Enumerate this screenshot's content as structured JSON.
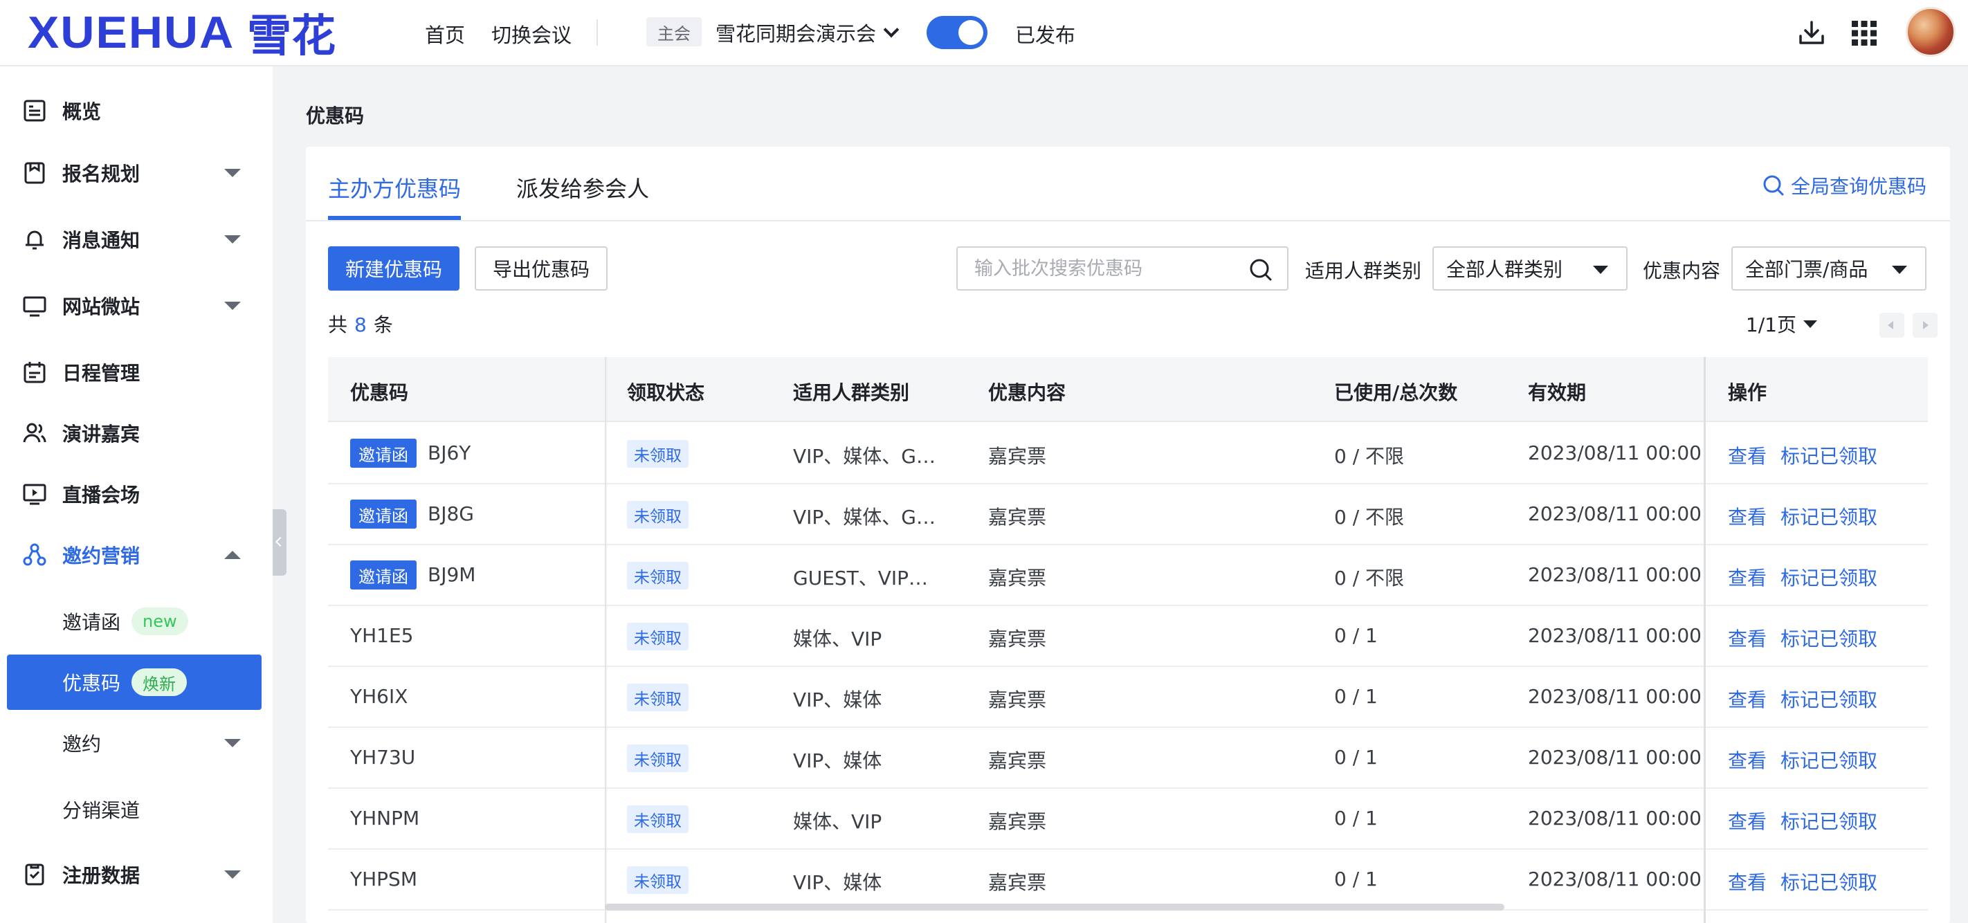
{
  "header": {
    "logo_en": "XUEHUA",
    "logo_cn": "雪花",
    "nav_home": "首页",
    "nav_switch": "切换会议",
    "main_tag": "主会",
    "event_name": "雪花同期会演示会",
    "published_label": "已发布",
    "published_on": true,
    "icons": [
      "download-icon",
      "apps-grid-icon",
      "avatar"
    ]
  },
  "sidebar": {
    "items": [
      {
        "label": "概览",
        "icon": "overview-icon"
      },
      {
        "label": "报名规划",
        "icon": "registration-plan-icon"
      },
      {
        "label": "消息通知",
        "icon": "bell-icon"
      },
      {
        "label": "网站微站",
        "icon": "monitor-icon"
      },
      {
        "label": "日程管理",
        "icon": "calendar-icon"
      },
      {
        "label": "演讲嘉宾",
        "icon": "speakers-icon"
      },
      {
        "label": "直播会场",
        "icon": "live-icon"
      },
      {
        "label": "邀约营销",
        "icon": "marketing-icon"
      }
    ],
    "sub_items": [
      {
        "label": "邀请函",
        "badge": "new"
      },
      {
        "label": "优惠码",
        "badge": "焕新"
      },
      {
        "label": "邀约"
      },
      {
        "label": "分销渠道"
      }
    ],
    "last_item": {
      "label": "注册数据",
      "icon": "register-data-icon"
    }
  },
  "main": {
    "page_title": "优惠码",
    "tabs": [
      {
        "label": "主办方优惠码"
      },
      {
        "label": "派发给参会人"
      }
    ],
    "global_search": "全局查询优惠码",
    "new_button": "新建优惠码",
    "export_button": "导出优惠码",
    "search_placeholder": "输入批次搜索优惠码",
    "filter_group_label": "适用人群类别",
    "filter_group_value": "全部人群类别",
    "filter_content_label": "优惠内容",
    "filter_content_value": "全部门票/商品",
    "total_prefix": "共",
    "total_count": "8",
    "total_suffix": "条",
    "pager": "1/1页"
  },
  "table": {
    "columns": [
      "优惠码",
      "领取状态",
      "适用人群类别",
      "优惠内容",
      "已使用/总次数",
      "有效期",
      "操作"
    ],
    "rows": [
      {
        "tag": "邀请函",
        "code": "BJ6Y",
        "status": "未领取",
        "group": "VIP、媒体、G…",
        "content": "嘉宾票",
        "usage": "0 / 不限",
        "validity": "2023/08/11 00:00 -",
        "action_view": "查看",
        "action_mark": "标记已领取"
      },
      {
        "tag": "邀请函",
        "code": "BJ8G",
        "status": "未领取",
        "group": "VIP、媒体、G…",
        "content": "嘉宾票",
        "usage": "0 / 不限",
        "validity": "2023/08/11 00:00 -",
        "action_view": "查看",
        "action_mark": "标记已领取"
      },
      {
        "tag": "邀请函",
        "code": "BJ9M",
        "status": "未领取",
        "group": "GUEST、VIP…",
        "content": "嘉宾票",
        "usage": "0 / 不限",
        "validity": "2023/08/11 00:00 -",
        "action_view": "查看",
        "action_mark": "标记已领取"
      },
      {
        "tag": "",
        "code": "YH1E5",
        "status": "未领取",
        "group": "媒体、VIP",
        "content": "嘉宾票",
        "usage": "0 / 1",
        "validity": "2023/08/11 00:00 -",
        "action_view": "查看",
        "action_mark": "标记已领取"
      },
      {
        "tag": "",
        "code": "YH6IX",
        "status": "未领取",
        "group": "VIP、媒体",
        "content": "嘉宾票",
        "usage": "0 / 1",
        "validity": "2023/08/11 00:00 -",
        "action_view": "查看",
        "action_mark": "标记已领取"
      },
      {
        "tag": "",
        "code": "YH73U",
        "status": "未领取",
        "group": "VIP、媒体",
        "content": "嘉宾票",
        "usage": "0 / 1",
        "validity": "2023/08/11 00:00 -",
        "action_view": "查看",
        "action_mark": "标记已领取"
      },
      {
        "tag": "",
        "code": "YHNPM",
        "status": "未领取",
        "group": "媒体、VIP",
        "content": "嘉宾票",
        "usage": "0 / 1",
        "validity": "2023/08/11 00:00 -",
        "action_view": "查看",
        "action_mark": "标记已领取"
      },
      {
        "tag": "",
        "code": "YHPSM",
        "status": "未领取",
        "group": "VIP、媒体",
        "content": "嘉宾票",
        "usage": "0 / 1",
        "validity": "2023/08/11 00:00 -",
        "action_view": "查看",
        "action_mark": "标记已领取"
      }
    ]
  },
  "colors": {
    "accent": "#2f6ae5",
    "logo": "#2d3fd6",
    "badge_green": "#34c759"
  }
}
